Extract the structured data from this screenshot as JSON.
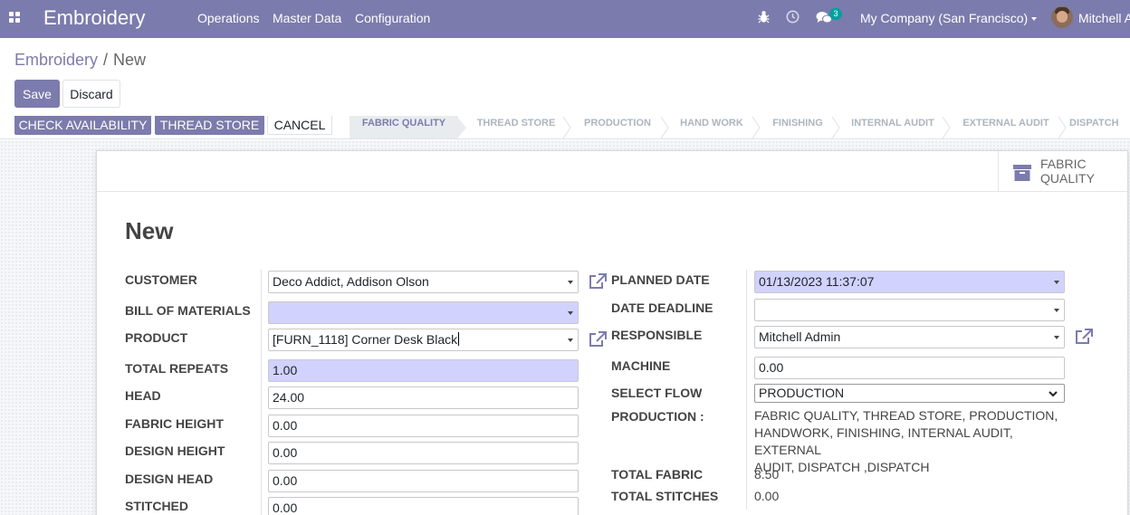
{
  "navbar": {
    "app_name": "Embroidery",
    "menus": [
      "Operations",
      "Master Data",
      "Configuration"
    ],
    "message_count": "3",
    "company": "My Company (San Francisco)",
    "user": "Mitchell Admin"
  },
  "breadcrumb": {
    "parent": "Embroidery",
    "current": "New"
  },
  "actions": {
    "save": "Save",
    "discard": "Discard"
  },
  "statusbar": {
    "buttons": [
      "CHECK AVAILABILITY",
      "THREAD STORE",
      "CANCEL"
    ],
    "stages": [
      "FABRIC QUALITY",
      "THREAD STORE",
      "PRODUCTION",
      "HAND WORK",
      "FINISHING",
      "INTERNAL AUDIT",
      "EXTERNAL AUDIT",
      "DISPATCH"
    ],
    "active_stage": "FABRIC QUALITY"
  },
  "smart_button": {
    "line1": "FABRIC",
    "line2": "QUALITY"
  },
  "record": {
    "title": "New"
  },
  "left_fields": {
    "customer": {
      "label": "CUSTOMER",
      "value": "Deco Addict, Addison Olson"
    },
    "bom": {
      "label": "BILL OF MATERIALS",
      "value": ""
    },
    "product": {
      "label": "PRODUCT",
      "value": "[FURN_1118] Corner Desk Black"
    },
    "total_repeats": {
      "label": "TOTAL REPEATS",
      "value": "1.00"
    },
    "head": {
      "label": "HEAD",
      "value": "24.00"
    },
    "fabric_height": {
      "label": "FABRIC HEIGHT",
      "value": "0.00"
    },
    "design_height": {
      "label": "DESIGN HEIGHT",
      "value": "0.00"
    },
    "design_head": {
      "label": "DESIGN HEAD",
      "value": "0.00"
    },
    "stitched": {
      "label": "STITCHED",
      "value": "0.00"
    }
  },
  "right_fields": {
    "planned_date": {
      "label": "PLANNED DATE",
      "value": "01/13/2023 11:37:07"
    },
    "date_deadline": {
      "label": "DATE DEADLINE",
      "value": ""
    },
    "responsible": {
      "label": "RESPONSIBLE",
      "value": "Mitchell Admin"
    },
    "machine": {
      "label": "MACHINE",
      "value": "0.00"
    },
    "select_flow": {
      "label": "SELECT FLOW",
      "value": "PRODUCTION"
    },
    "production": {
      "label": "PRODUCTION :",
      "line1": "FABRIC QUALITY, THREAD STORE, PRODUCTION,",
      "line2": "HANDWORK, FINISHING, INTERNAL AUDIT, EXTERNAL",
      "line3": "AUDIT, DISPATCH ,DISPATCH"
    },
    "total_fabric": {
      "label": "TOTAL FABRIC",
      "value": "8.50"
    },
    "total_stitches": {
      "label": "TOTAL STITCHES",
      "value": "0.00"
    }
  },
  "colors": {
    "brand": "#7c7bad",
    "required_field": "#d2d2ff",
    "badge": "#00a09d"
  }
}
